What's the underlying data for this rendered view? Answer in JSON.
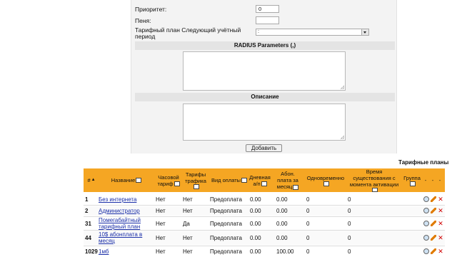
{
  "form": {
    "priority_label": "Приоритет:",
    "priority_value": "0",
    "penalty_label": "Пеня:",
    "penalty_value": "",
    "tariff_next_label_1": "Тарифный план Следующий учётный",
    "tariff_next_label_2": "период",
    "tariff_next_value": ":",
    "radius_header": "RADIUS Parameters (,)",
    "description_header": "Описание",
    "add_button": "Добавить"
  },
  "table": {
    "caption": "Тарифные планы",
    "headers": {
      "num": "#",
      "name": "Название",
      "hourly_1": "Часовой",
      "hourly_2": "тариф",
      "traffic_1": "Тарифы",
      "traffic_2": "трафика",
      "payment": "Вид оплаты",
      "daily_1": "Дневная",
      "daily_2": "а/п",
      "monthly_1": "Абон.",
      "monthly_2": "плата за",
      "monthly_3": "месяц",
      "simultaneous": "Одновременно",
      "lifetime_1": "Время",
      "lifetime_2": "существования с",
      "lifetime_3": "момента активации",
      "group": "Группа",
      "dash1": "-",
      "dash2": "-",
      "dash3": "-"
    },
    "rows": [
      {
        "num": "1",
        "name": "Без интернета",
        "hourly": "Нет",
        "traffic": "Нет",
        "payment": "Предоплата",
        "daily": "0.00",
        "monthly": "0.00",
        "simultaneous": "0",
        "lifetime": "0"
      },
      {
        "num": "2",
        "name": "Администратор",
        "hourly": "Нет",
        "traffic": "Нет",
        "payment": "Предоплата",
        "daily": "0.00",
        "monthly": "0.00",
        "simultaneous": "0",
        "lifetime": "0"
      },
      {
        "num": "31",
        "name_1": "Помегабайтный",
        "name_2": "тарифный план",
        "hourly": "Нет",
        "traffic": "Да",
        "payment": "Предоплата",
        "daily": "0.00",
        "monthly": "0.00",
        "simultaneous": "0",
        "lifetime": "0"
      },
      {
        "num": "44",
        "name_1": "10$ абонплата в",
        "name_2": "месяц",
        "hourly": "Нет",
        "traffic": "Нет",
        "payment": "Предоплата",
        "daily": "0.00",
        "monthly": "0.00",
        "simultaneous": "0",
        "lifetime": "0"
      },
      {
        "num": "1029",
        "name": "1мб",
        "hourly": "Нет",
        "traffic": "Нет",
        "payment": "Предоплата",
        "daily": "0.00",
        "monthly": "100.00",
        "simultaneous": "0",
        "lifetime": "0"
      }
    ]
  },
  "colors": {
    "header": "#f5a623",
    "link": "#1a2ea8",
    "panel": "#f3f3f3",
    "delete": "#d00000"
  }
}
